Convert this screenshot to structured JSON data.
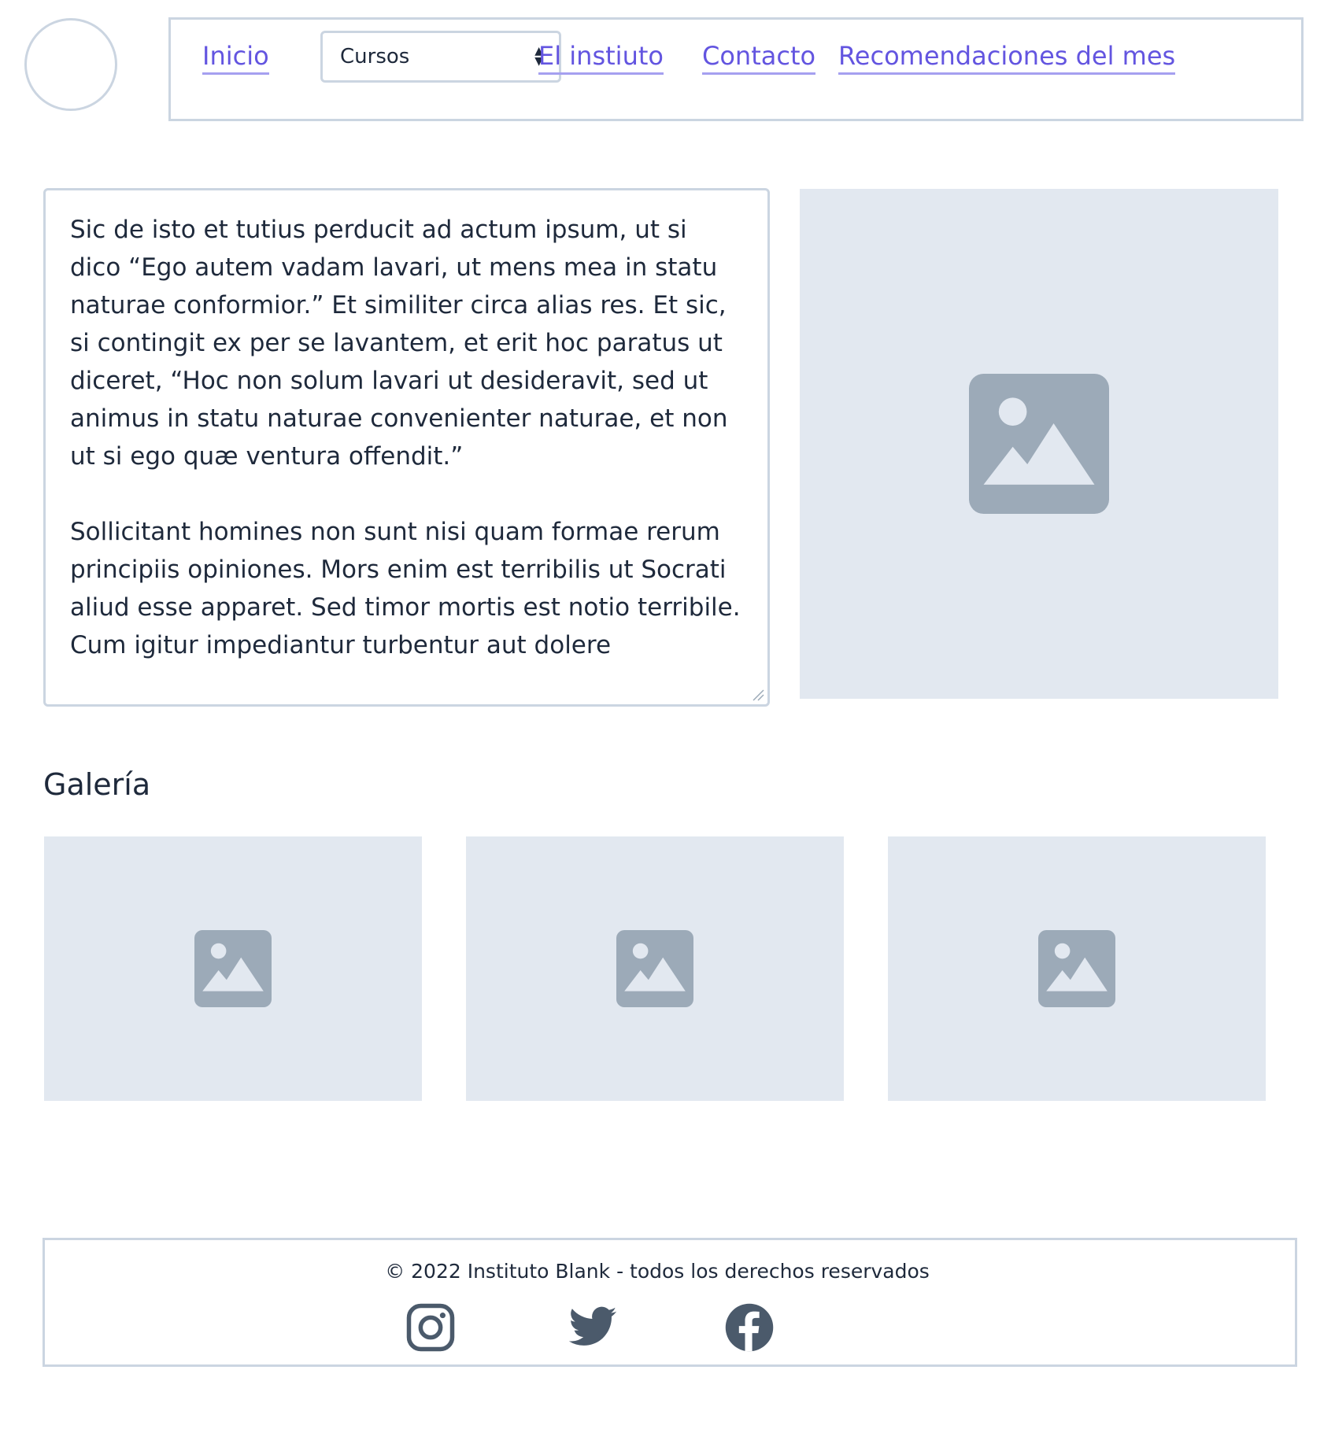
{
  "header": {
    "logo_icon": "circle-logo",
    "nav": {
      "inicio": "Inicio",
      "cursos_selected": "Cursos",
      "instituto": "El instiuto",
      "contacto": "Contacto",
      "recomendaciones": "Recomendaciones del mes"
    }
  },
  "main": {
    "paragraph_1": "Sic de isto et tutius perducit ad actum ipsum, ut si dico “Ego autem vadam lavari, ut mens mea in statu naturae conformior.” Et similiter circa alias res. Et sic, si contingit ex per se lavantem, et erit hoc paratus ut diceret, “Hoc non solum lavari ut desideravit, sed ut animus in statu naturae convenienter naturae, et non ut si ego quæ ventura offendit.”",
    "paragraph_2": "Sollicitant homines non sunt nisi quam formae rerum principiis opiniones. Mors enim est terribilis ut Socrati aliud esse apparet. Sed timor mortis est notio terribile. Cum igitur impediantur turbentur aut dolere",
    "hero_image_icon": "image-placeholder-icon"
  },
  "gallery": {
    "title": "Galería",
    "items": [
      {
        "icon": "image-placeholder-icon"
      },
      {
        "icon": "image-placeholder-icon"
      },
      {
        "icon": "image-placeholder-icon"
      }
    ]
  },
  "footer": {
    "copyright": "© 2022 Instituto Blank - todos los derechos reservados",
    "social_icons": [
      "instagram-icon",
      "twitter-icon",
      "facebook-icon"
    ]
  },
  "colors": {
    "link": "#6355e0",
    "border": "#cbd5e1",
    "placeholder_bg": "#e2e8f0",
    "placeholder_icon": "#9caab8",
    "social_icon": "#4b5a6b",
    "text": "#1e293b"
  }
}
